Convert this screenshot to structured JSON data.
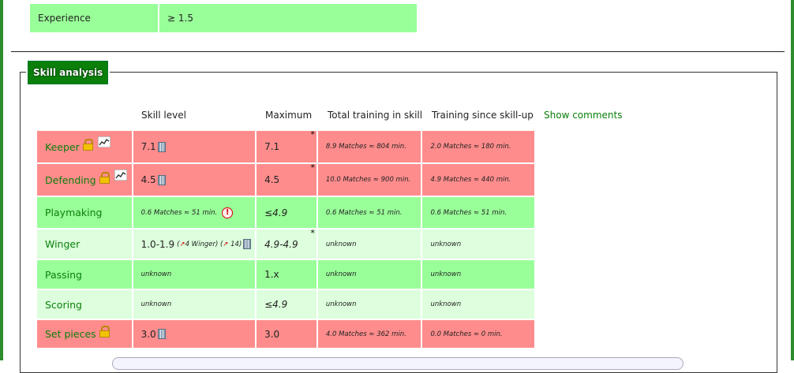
{
  "experience": {
    "label": "Experience",
    "value": "≥ 1.5"
  },
  "section": {
    "title": "Skill analysis"
  },
  "headers": {
    "skill_level": "Skill level",
    "maximum": "Maximum",
    "total_training": "Total training in skill",
    "training_since": "Training since skill-up",
    "show_comments": "Show comments"
  },
  "rows": [
    {
      "name": "Keeper",
      "color": "#ff8c8c",
      "level": "7.1",
      "maximum": "7.1",
      "star": "*",
      "total": "8.9 Matches ≈ 804 min.",
      "since": "2.0 Matches ≈ 180 min."
    },
    {
      "name": "Defending",
      "color": "#ff8c8c",
      "level": "4.5",
      "maximum": "4.5",
      "star": "*",
      "total": "10.0 Matches ≈ 900 min.",
      "since": "4.9 Matches ≈ 440 min."
    },
    {
      "name": "Playmaking",
      "color": "#99ff99",
      "level": "0.6 Matches ≈ 51 min.",
      "warn": "!",
      "maximum": "≤4.9",
      "total": "0.6 Matches ≈ 51 min.",
      "since": "0.6 Matches ≈ 51 min."
    },
    {
      "name": "Winger",
      "color": "#ddffdd",
      "level": "1.0-1.9",
      "level_note1": "4 Winger",
      "level_note2": "14",
      "up_arrow": "↗",
      "maximum": "4.9-4.9",
      "star": "*",
      "total": "unknown",
      "since": "unknown"
    },
    {
      "name": "Passing",
      "color": "#99ff99",
      "level": "unknown",
      "maximum": "1.x",
      "total": "unknown",
      "since": "unknown"
    },
    {
      "name": "Scoring",
      "color": "#ddffdd",
      "level": "unknown",
      "maximum": "≤4.9",
      "total": "unknown",
      "since": "unknown"
    },
    {
      "name": "Set pieces",
      "color": "#ff8c8c",
      "level": "3.0",
      "maximum": "3.0",
      "total": "4.0 Matches ≈ 362 min.",
      "since": "0.0 Matches ≈ 0 min."
    }
  ],
  "icons": {
    "lock": "lock-icon",
    "chart": "chart-icon",
    "calculator": "calculator-icon",
    "warning": "warning-icon"
  }
}
